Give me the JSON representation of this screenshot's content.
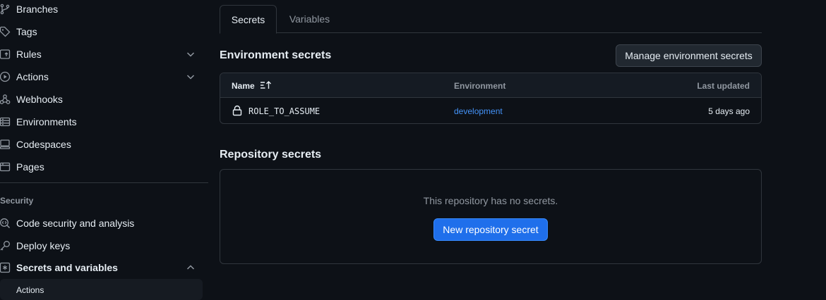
{
  "sidebar": {
    "items": [
      {
        "label": "Branches",
        "icon": "branch-icon"
      },
      {
        "label": "Tags",
        "icon": "tag-icon"
      },
      {
        "label": "Rules",
        "icon": "rules-icon"
      },
      {
        "label": "Actions",
        "icon": "play-icon"
      },
      {
        "label": "Webhooks",
        "icon": "webhook-icon"
      },
      {
        "label": "Environments",
        "icon": "server-icon"
      },
      {
        "label": "Codespaces",
        "icon": "codespaces-icon"
      },
      {
        "label": "Pages",
        "icon": "browser-icon"
      }
    ],
    "security_heading": "Security",
    "security_items": [
      {
        "label": "Code security and analysis",
        "icon": "codescan-icon"
      },
      {
        "label": "Deploy keys",
        "icon": "key-icon"
      },
      {
        "label": "Secrets and variables",
        "icon": "asterisk-icon"
      }
    ],
    "sub_item": "Actions"
  },
  "tabs": {
    "secrets": "Secrets",
    "variables": "Variables"
  },
  "environment_secrets": {
    "title": "Environment secrets",
    "manage_button": "Manage environment secrets",
    "columns": {
      "name": "Name",
      "environment": "Environment",
      "last_updated": "Last updated"
    },
    "rows": [
      {
        "name": "ROLE_TO_ASSUME",
        "environment": "development",
        "updated": "5 days ago"
      }
    ]
  },
  "repository_secrets": {
    "title": "Repository secrets",
    "empty_message": "This repository has no secrets.",
    "new_button": "New repository secret"
  },
  "colors": {
    "background": "#0d1117",
    "border": "#30363d",
    "link": "#4493f8",
    "primary_button": "#1f6feb",
    "muted_text": "#9198a1"
  }
}
